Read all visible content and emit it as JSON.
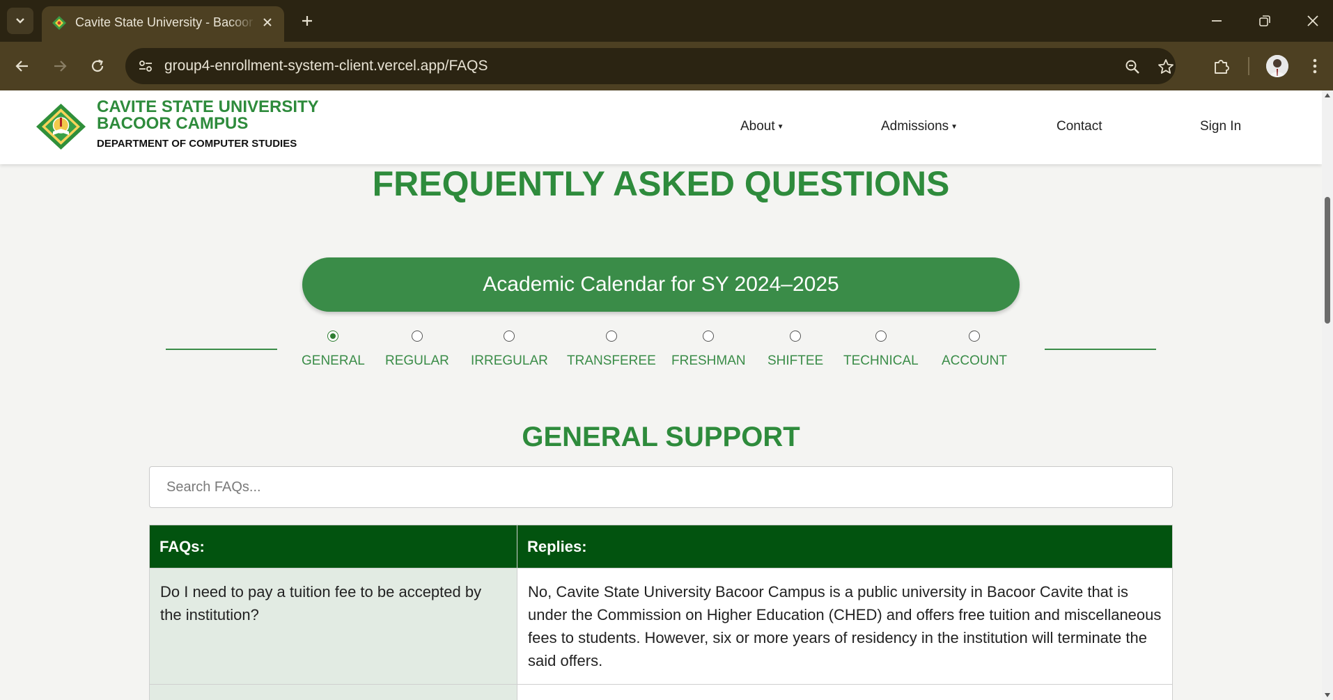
{
  "browser": {
    "tab_title": "Cavite State University - Bacoor Campus",
    "url": "group4-enrollment-system-client.vercel.app/FAQS"
  },
  "header": {
    "brand_line1": "CAVITE STATE UNIVERSITY",
    "brand_line2": "BACOOR CAMPUS",
    "department": "DEPARTMENT OF COMPUTER STUDIES",
    "nav": {
      "about": "About",
      "admissions": "Admissions",
      "contact": "Contact",
      "sign_in": "Sign In"
    }
  },
  "page": {
    "title": "FREQUENTLY ASKED QUESTIONS",
    "calendar_button": "Academic Calendar for SY 2024–2025",
    "categories": [
      "GENERAL",
      "REGULAR",
      "IRREGULAR",
      "TRANSFEREE",
      "FRESHMAN",
      "SHIFTEE",
      "TECHNICAL",
      "ACCOUNT"
    ],
    "selected_category": "GENERAL",
    "section_title": "GENERAL SUPPORT",
    "search": {
      "placeholder": "Search FAQs...",
      "value": ""
    },
    "table": {
      "headers": [
        "FAQs:",
        "Replies:"
      ],
      "rows": [
        {
          "question": "Do I need to pay a tuition fee to be accepted by the institution?",
          "answer": "No, Cavite State University Bacoor Campus is a public university in Bacoor Cavite that is under the Commission on Higher Education (CHED) and offers free tuition and miscellaneous fees to students. However, six or more years of residency in the institution will terminate the said offers."
        }
      ]
    }
  },
  "colors": {
    "brand_green": "#2e8b3c",
    "button_green": "#3a8c48",
    "table_header_green": "#02530f",
    "question_cell_bg": "#e2ebe3",
    "chrome_dark": "#2b2412",
    "chrome_toolbar": "#4d4022"
  },
  "icons": {
    "tab_menu": "chevron-down-icon",
    "favicon": "cvsu-favicon-icon",
    "tab_close": "close-icon",
    "new_tab": "plus-icon",
    "back": "arrow-left-icon",
    "forward": "arrow-right-icon",
    "reload": "reload-icon",
    "site_info": "tune-icon",
    "zoom": "zoom-icon",
    "bookmark": "star-icon",
    "extensions": "puzzle-icon",
    "menu": "kebab-menu-icon"
  }
}
